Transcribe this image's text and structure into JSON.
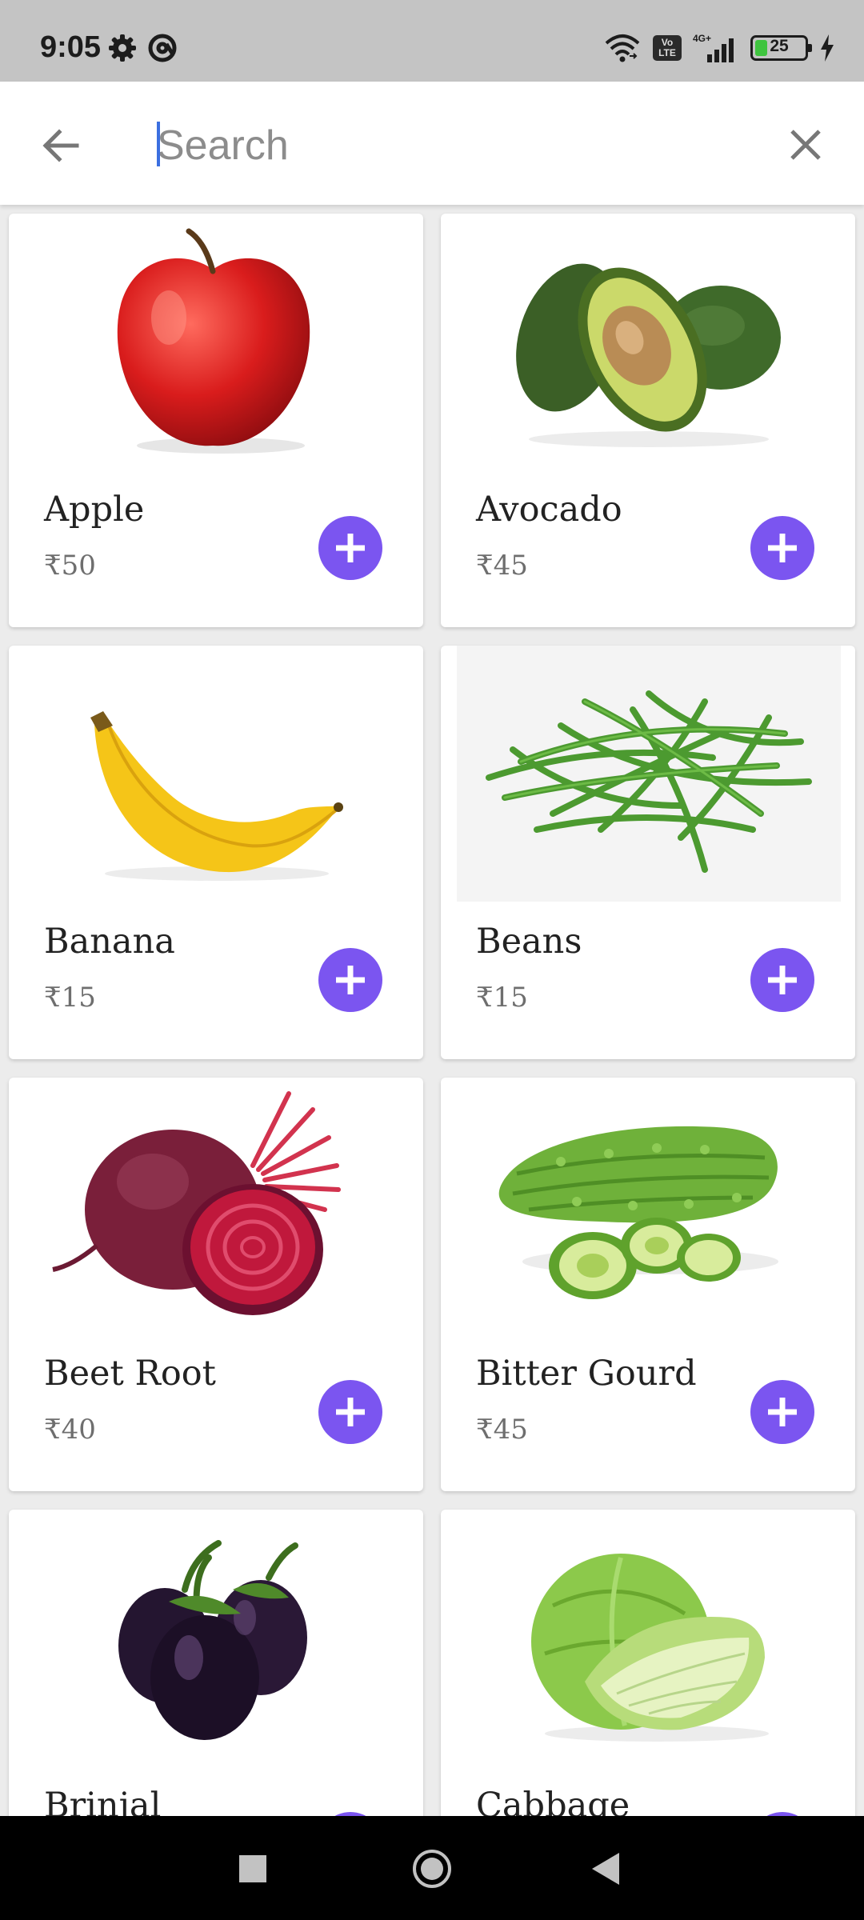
{
  "status_bar": {
    "time": "9:05",
    "icons": [
      "gear-icon",
      "at-sign-icon",
      "wifi-icon",
      "volte-icon",
      "signal-icon",
      "battery-icon",
      "charging-bolt-icon"
    ],
    "volte_top": "Vo",
    "volte_bottom": "LTE",
    "network": "4G+",
    "battery_level": "25",
    "battery_fraction": 0.25
  },
  "search": {
    "placeholder": "Search",
    "value": "",
    "back_icon": "back-arrow-icon",
    "clear_icon": "close-icon"
  },
  "theme": {
    "accent": "#7b55f0",
    "caret": "#3b6fe0"
  },
  "products": [
    {
      "name": "Apple",
      "price": "₹50",
      "image": "apple"
    },
    {
      "name": "Avocado",
      "price": "₹45",
      "image": "avocado"
    },
    {
      "name": "Banana",
      "price": "₹15",
      "image": "banana"
    },
    {
      "name": "Beans",
      "price": "₹15",
      "image": "beans"
    },
    {
      "name": "Beet Root",
      "price": "₹40",
      "image": "beet-root"
    },
    {
      "name": "Bitter Gourd",
      "price": "₹45",
      "image": "bitter-gourd"
    },
    {
      "name": "Brinjal",
      "price": "",
      "image": "brinjal"
    },
    {
      "name": "Cabbage",
      "price": "",
      "image": "cabbage"
    }
  ],
  "nav_bar": {
    "icons": [
      "recents-square-icon",
      "home-circle-icon",
      "back-triangle-icon"
    ]
  }
}
